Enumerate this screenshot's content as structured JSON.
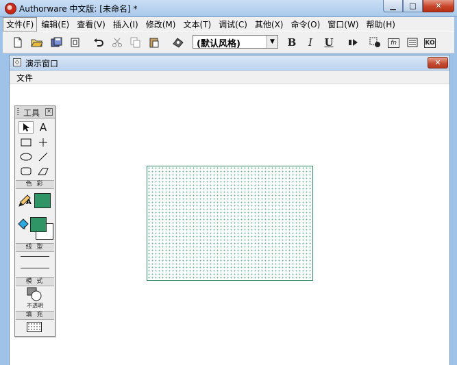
{
  "window": {
    "title": "Authorware 中文版: [未命名] *",
    "controls": {
      "minimize_icon": "minimize-icon",
      "maximize_icon": "maximize-icon",
      "close_icon": "close-icon"
    }
  },
  "menubar": {
    "items": [
      "文件(F)",
      "编辑(E)",
      "查看(V)",
      "插入(I)",
      "修改(M)",
      "文本(T)",
      "调试(C)",
      "其他(X)",
      "命令(O)",
      "窗口(W)",
      "帮助(H)"
    ]
  },
  "toolbar": {
    "style_select_value": "(默认风格)",
    "bold_label": "B",
    "italic_label": "I",
    "underline_label": "U",
    "fn_label": "fn",
    "ko_label": "KO"
  },
  "presentation_window": {
    "title": "演示窗口",
    "menu_file": "文件"
  },
  "palette": {
    "title": "工具",
    "text_tool_label": "A",
    "color_label": "色 彩",
    "color_text_marker": "A",
    "line_label": "线 型",
    "mode_label": "模 式",
    "mode_value": "不透明",
    "fill_label": "填 充"
  },
  "colors": {
    "line_color": "#2f9466",
    "fill_color": "#2f9466",
    "shape_pattern": "#6ab597"
  }
}
